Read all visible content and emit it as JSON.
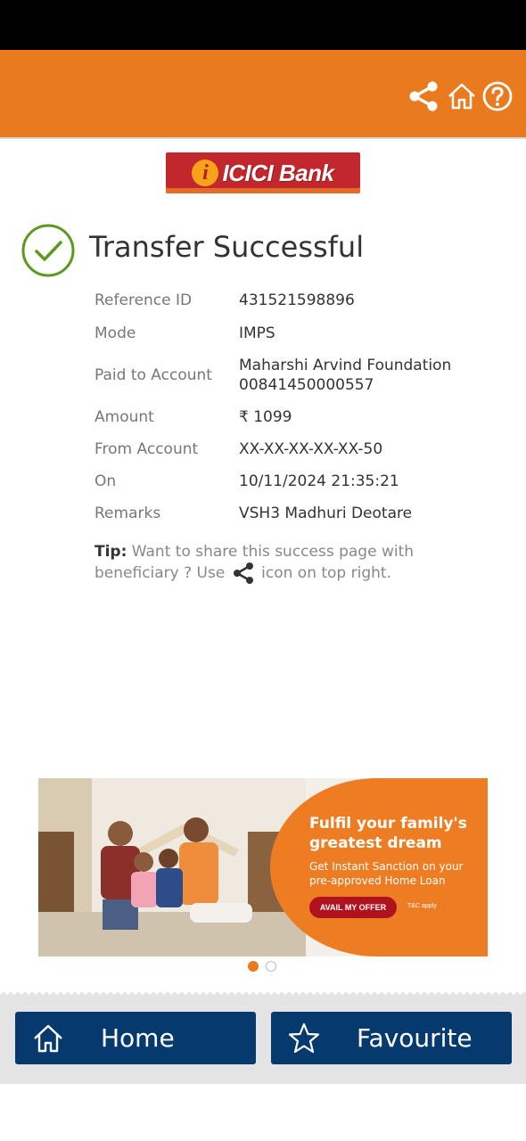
{
  "header": {
    "share_icon": "share-icon",
    "home_icon": "home-icon",
    "help_icon": "help-icon",
    "background_color": "#e97b1e"
  },
  "logo": {
    "text": "ICICI Bank",
    "mark": "i",
    "background_color": "#c2272d"
  },
  "confirmation": {
    "title": "Transfer Successful",
    "icon": "check-circle-icon",
    "icon_color": "#5b9a1f"
  },
  "details": [
    {
      "label": "Reference ID",
      "value": "431521598896"
    },
    {
      "label": "Mode",
      "value": "IMPS"
    },
    {
      "label": "Paid to Account",
      "value": "Maharshi Arvind Foundation",
      "value2": "00841450000557"
    },
    {
      "label": "Amount",
      "value": "₹ 1099"
    },
    {
      "label": "From Account",
      "value": "XX-XX-XX-XX-XX-50"
    },
    {
      "label": "On",
      "value": "10/11/2024 21:35:21"
    },
    {
      "label": "Remarks",
      "value": "VSH3 Madhuri Deotare"
    }
  ],
  "tip": {
    "prefix": "Tip:",
    "text1": " Want to share this success page with beneficiary ? Use ",
    "text2": " icon on top right."
  },
  "banner": {
    "headline": "Fulfil your family's greatest dream",
    "subtext": "Get Instant Sanction on your pre-approved Home Loan",
    "cta": "AVAIL MY OFFER",
    "tc": "T&C apply",
    "total_slides": 2,
    "active_slide": 1
  },
  "bottom_nav": {
    "home_label": "Home",
    "home_icon": "home-outline-icon",
    "favourite_label": "Favourite",
    "favourite_icon": "star-outline-icon",
    "button_color": "#063a6f"
  }
}
